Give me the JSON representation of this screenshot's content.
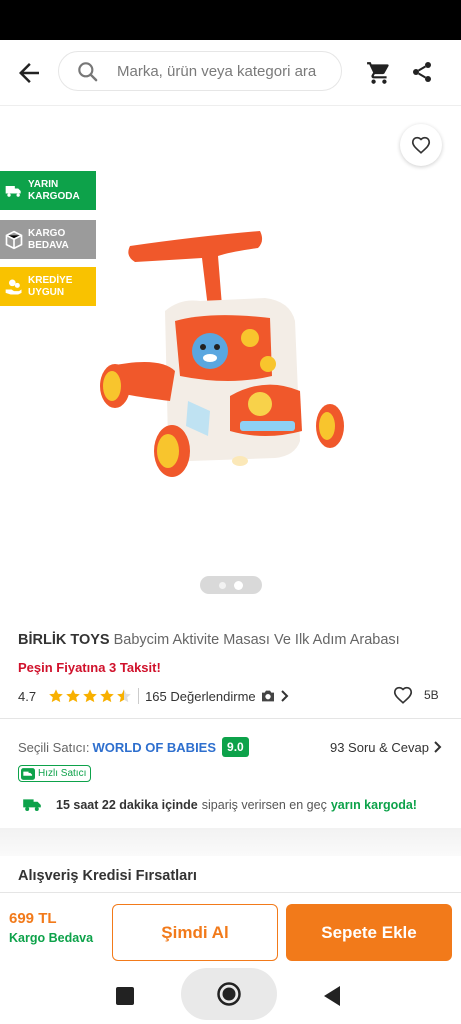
{
  "search": {
    "placeholder": "Marka, ürün veya kategori ara"
  },
  "badges": {
    "next_day": "YARIN KARGODA",
    "free_shipping": "KARGO BEDAVA",
    "credit": "KREDİYE UYGUN"
  },
  "product": {
    "brand": "BİRLİK TOYS",
    "name": "Babycim Aktivite Masası Ve Ilk Adım Arabası",
    "installment": "Peşin Fiyatına 3 Taksit!",
    "rating": "4.7",
    "rating_stars": 4.5,
    "review_count": "165 Değerlendirme",
    "likes": "5B"
  },
  "gallery": {
    "image_count": 2,
    "active_index": 1
  },
  "seller": {
    "label": "Seçili Satıcı:",
    "name": "WORLD OF BABIES",
    "score": "9.0",
    "qa": "93 Soru & Cevap",
    "fast_label": "Hızlı Satıcı"
  },
  "delivery": {
    "time": "15 saat 22 dakika içinde",
    "middle": "sipariş verirsen en geç",
    "result": "yarın kargoda!"
  },
  "credit": {
    "title": "Alışveriş Kredisi Fırsatları"
  },
  "footer": {
    "price": "699 TL",
    "shipping": "Kargo Bedava",
    "buy_now": "Şimdi Al",
    "add_to_cart": "Sepete Ekle"
  },
  "colors": {
    "accent": "#f27a1a",
    "green": "#0da24a",
    "red": "#d0112b",
    "link": "#2e6fce"
  }
}
